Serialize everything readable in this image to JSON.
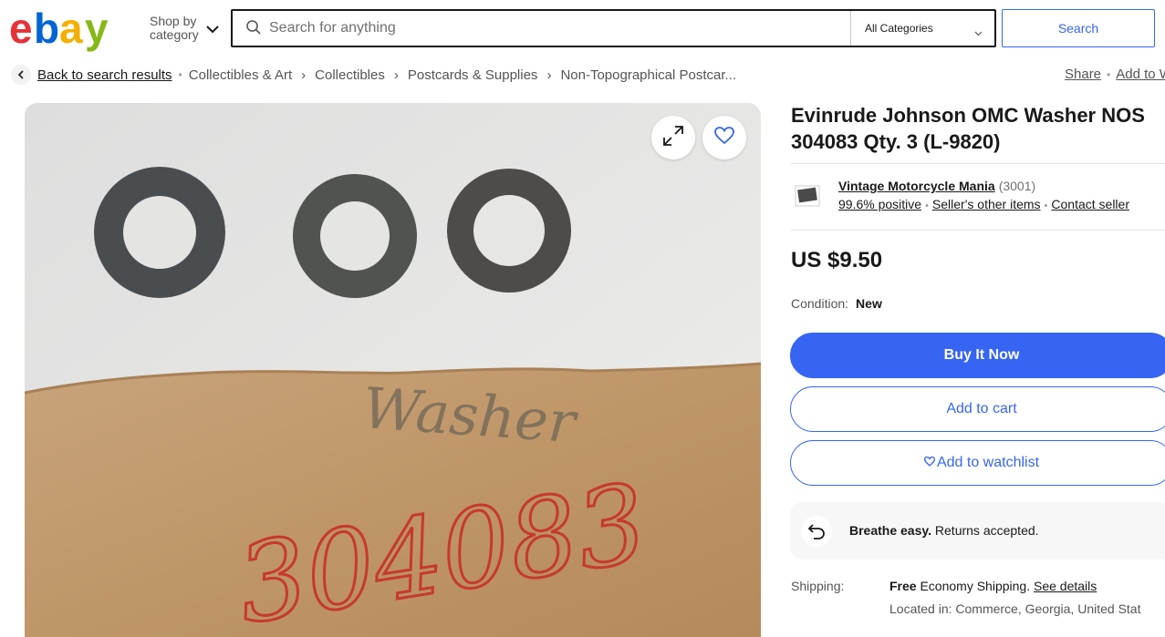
{
  "header": {
    "logo_letters": [
      "e",
      "b",
      "a",
      "y"
    ],
    "logo_colors": [
      "#e53238",
      "#0064d2",
      "#f5af02",
      "#86b817"
    ],
    "shop_by_line1": "Shop by",
    "shop_by_line2": "category",
    "search_placeholder": "Search for anything",
    "category_selected": "All Categories",
    "search_button": "Search",
    "accent_color": "#3665f3"
  },
  "breadcrumb": {
    "back": "Back to search results",
    "items": [
      "Collectibles & Art",
      "Collectibles",
      "Postcards & Supplies",
      "Non-Topographical Postcar..."
    ],
    "share": "Share",
    "add_to": "Add to W"
  },
  "image": {
    "handwriting_pencil": "Washer",
    "handwriting_red": "304083"
  },
  "listing": {
    "title": "Evinrude Johnson OMC Washer NOS 304083 Qty. 3 (L-9820)",
    "seller": {
      "name": "Vintage Motorcycle Mania",
      "feedback_count": "(3001)",
      "positive": "99.6% positive",
      "other_items": "Seller's other items",
      "contact": "Contact seller"
    },
    "price": "US $9.50",
    "condition_label": "Condition:",
    "condition_value": "New",
    "buttons": {
      "buy": "Buy It Now",
      "cart": "Add to cart",
      "watch": "Add to watchlist"
    },
    "returns": {
      "bold": "Breathe easy.",
      "text": " Returns accepted."
    },
    "shipping": {
      "label": "Shipping:",
      "free": "Free",
      "method": " Economy Shipping. ",
      "details": "See details",
      "location": "Located in: Commerce, Georgia, United Stat"
    }
  },
  "icons": {
    "expand": "expand-icon",
    "heart": "heart-icon",
    "search": "search-icon",
    "returns": "return-arrow-icon"
  }
}
